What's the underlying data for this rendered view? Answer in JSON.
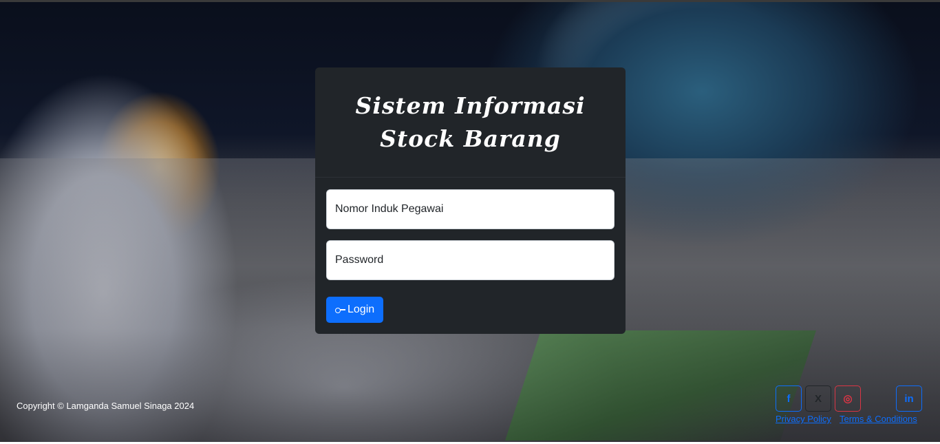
{
  "login": {
    "title": "Sistem Informasi Stock Barang",
    "nip_placeholder": "Nomor Induk Pegawai",
    "password_placeholder": "Password",
    "login_label": "Login"
  },
  "footer": {
    "copyright": "Copyright © Lamganda Samuel Sinaga 2024",
    "privacy_label": "Privacy Policy",
    "terms_label": "Terms & Conditions",
    "social": [
      {
        "icon": "facebook-icon",
        "glyph": "f",
        "color": "#0d6efd"
      },
      {
        "icon": "x-icon",
        "glyph": "X",
        "color": "#212529"
      },
      {
        "icon": "instagram-icon",
        "glyph": "◎",
        "color": "#dc3545"
      },
      {
        "icon": "linkedin-icon",
        "glyph": "in",
        "color": "#0d6efd"
      }
    ]
  },
  "colors": {
    "card_bg": "#212529",
    "primary": "#0d6efd"
  }
}
